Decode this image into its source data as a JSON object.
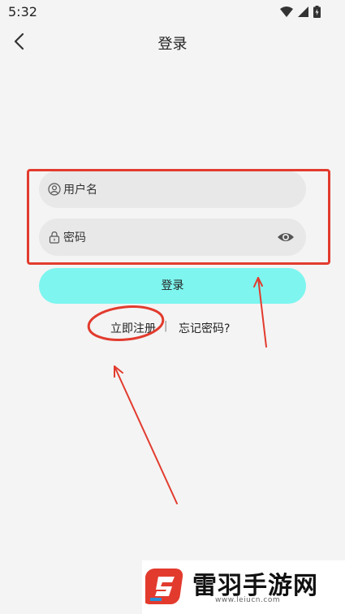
{
  "status_bar": {
    "time": "5:32"
  },
  "header": {
    "title": "登录"
  },
  "form": {
    "username_placeholder": "用户名",
    "password_placeholder": "密码",
    "login_label": "登录"
  },
  "links": {
    "register": "立即注册",
    "separator": "|",
    "forgot_password": "忘记密码?"
  },
  "watermark": {
    "title": "雷羽手游网",
    "url": "www.leiucn.com"
  },
  "colors": {
    "background": "#f4f4f4",
    "input_bg": "#e8e8e8",
    "login_button": "#7ef5ef",
    "annotation": "#e23b2e"
  }
}
